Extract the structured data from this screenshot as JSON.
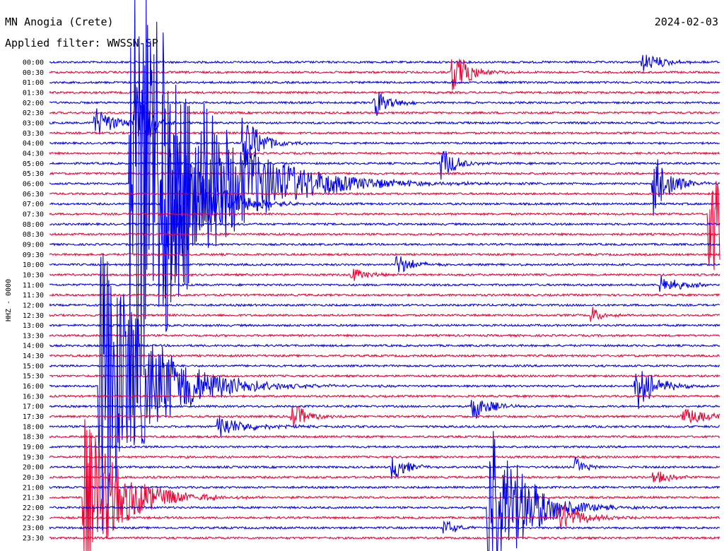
{
  "header": {
    "station": "MN Anogia (Crete)",
    "date": "2024-02-03",
    "filter": "Applied filter: WWSSN-SP"
  },
  "chart_data": {
    "type": "helicorder",
    "ylabel": "HHZ - 0000",
    "line_labels": [
      "00:00",
      "00:30",
      "01:00",
      "01:30",
      "02:00",
      "02:30",
      "03:00",
      "03:30",
      "04:00",
      "04:30",
      "05:00",
      "05:30",
      "06:00",
      "06:30",
      "07:00",
      "07:30",
      "08:00",
      "08:30",
      "09:00",
      "09:30",
      "10:00",
      "10:30",
      "11:00",
      "11:30",
      "12:00",
      "12:30",
      "13:00",
      "13:30",
      "14:00",
      "14:30",
      "15:00",
      "15:30",
      "16:00",
      "16:30",
      "17:00",
      "17:30",
      "18:00",
      "18:30",
      "19:00",
      "19:30",
      "20:00",
      "20:30",
      "21:00",
      "21:30",
      "22:00",
      "22:30",
      "23:00",
      "23:30"
    ],
    "line_minutes": 30,
    "colors": [
      "#0000ee",
      "#ee0033"
    ],
    "events": [
      {
        "line": 0,
        "minute": 26.5,
        "amp": 14,
        "dur": 2.2
      },
      {
        "line": 1,
        "minute": 18.0,
        "amp": 40,
        "dur": 1.5
      },
      {
        "line": 4,
        "minute": 14.5,
        "amp": 24,
        "dur": 1.5
      },
      {
        "line": 6,
        "minute": 2.0,
        "amp": 26,
        "dur": 1.8
      },
      {
        "line": 6,
        "minute": 3.8,
        "amp": 90,
        "dur": 1.0
      },
      {
        "line": 8,
        "minute": 8.6,
        "amp": 50,
        "dur": 1.6
      },
      {
        "line": 10,
        "minute": 17.5,
        "amp": 26,
        "dur": 1.5
      },
      {
        "line": 12,
        "minute": 27.0,
        "amp": 55,
        "dur": 1.5
      },
      {
        "line": 12,
        "minute": 3.6,
        "amp": 400,
        "dur": 6.0
      },
      {
        "line": 14,
        "minute": 5.0,
        "amp": 180,
        "dur": 3.0
      },
      {
        "line": 15,
        "minute": 29.5,
        "amp": 130,
        "dur": 3.0
      },
      {
        "line": 20,
        "minute": 15.5,
        "amp": 18,
        "dur": 1.5
      },
      {
        "line": 21,
        "minute": 13.5,
        "amp": 12,
        "dur": 1.5
      },
      {
        "line": 22,
        "minute": 27.3,
        "amp": 14,
        "dur": 2.0
      },
      {
        "line": 25,
        "minute": 24.2,
        "amp": 14,
        "dur": 1.0
      },
      {
        "line": 32,
        "minute": 2.2,
        "amp": 230,
        "dur": 4.5
      },
      {
        "line": 32,
        "minute": 26.2,
        "amp": 40,
        "dur": 1.8
      },
      {
        "line": 34,
        "minute": 18.9,
        "amp": 24,
        "dur": 1.5
      },
      {
        "line": 35,
        "minute": 10.8,
        "amp": 22,
        "dur": 1.6
      },
      {
        "line": 35,
        "minute": 28.3,
        "amp": 12,
        "dur": 3.0
      },
      {
        "line": 36,
        "minute": 7.5,
        "amp": 18,
        "dur": 2.8
      },
      {
        "line": 40,
        "minute": 15.3,
        "amp": 22,
        "dur": 1.5
      },
      {
        "line": 40,
        "minute": 23.5,
        "amp": 16,
        "dur": 1.0
      },
      {
        "line": 41,
        "minute": 27.0,
        "amp": 12,
        "dur": 1.5
      },
      {
        "line": 43,
        "minute": 1.5,
        "amp": 120,
        "dur": 3.5
      },
      {
        "line": 44,
        "minute": 19.6,
        "amp": 160,
        "dur": 3.0
      },
      {
        "line": 45,
        "minute": 22.8,
        "amp": 24,
        "dur": 2.2
      },
      {
        "line": 46,
        "minute": 17.6,
        "amp": 14,
        "dur": 1.2
      }
    ],
    "grid": false
  }
}
